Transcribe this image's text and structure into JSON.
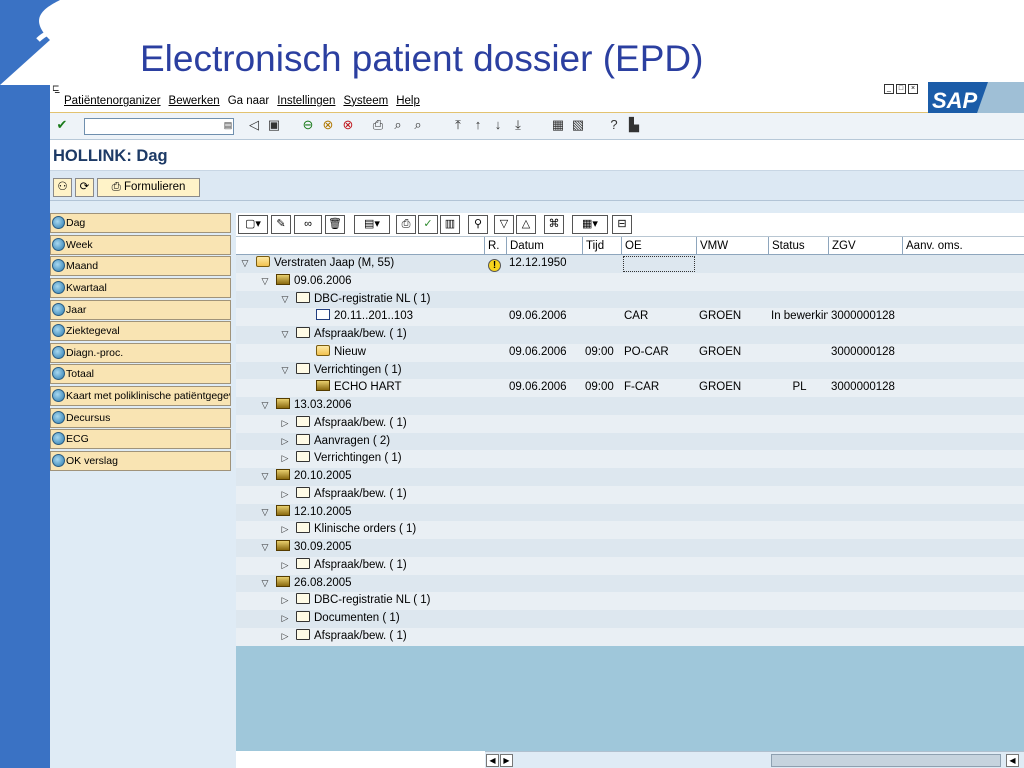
{
  "slide": {
    "title": "Electronisch patient dossier (EPD)"
  },
  "menu": [
    "Patiëntenorganizer",
    "Bewerken",
    "Ga naar",
    "Instellingen",
    "Systeem",
    "Help"
  ],
  "brand": {
    "logo_text": "SAP"
  },
  "screen": {
    "title": "HOLLINK: Dag"
  },
  "app_toolbar": {
    "formulieren_label": "Formulieren"
  },
  "nav_items": [
    "Dag",
    "Week",
    "Maand",
    "Kwartaal",
    "Jaar",
    "Ziektegeval",
    "Diagn.-proc.",
    "Totaal",
    "Kaart met poliklinische patiëntgegevens",
    "Decursus",
    "ECG",
    "OK verslag"
  ],
  "columns": {
    "r": "R.",
    "datum": "Datum",
    "tijd": "Tijd",
    "oe": "OE",
    "vmw": "VMW",
    "status": "Status",
    "zgv": "ZGV",
    "aanv": "Aanv. oms."
  },
  "rows": [
    {
      "level": 0,
      "toggle": "▽",
      "icon": "person",
      "label": "Verstraten Jaap (M, 55)",
      "r": "!",
      "datum": "12.12.1950",
      "tijd": "",
      "oe": "",
      "vmw": "",
      "status": "",
      "zgv": ""
    },
    {
      "level": 1,
      "toggle": "▽",
      "icon": "date",
      "label": "09.06.2006",
      "r": "",
      "datum": "",
      "tijd": "",
      "oe": "",
      "vmw": "",
      "status": "",
      "zgv": ""
    },
    {
      "level": 2,
      "toggle": "▽",
      "icon": "folder",
      "label": "DBC-registratie NL ( 1)",
      "r": "",
      "datum": "",
      "tijd": "",
      "oe": "",
      "vmw": "",
      "status": "",
      "zgv": ""
    },
    {
      "level": 3,
      "toggle": "",
      "icon": "doc",
      "label": "20.11..201..103",
      "r": "",
      "datum": "09.06.2006",
      "tijd": "",
      "oe": "CAR",
      "vmw": "GROEN",
      "status": "In bewerking",
      "zgv": "3000000128"
    },
    {
      "level": 2,
      "toggle": "▽",
      "icon": "folder",
      "label": "Afspraak/bew. ( 1)",
      "r": "",
      "datum": "",
      "tijd": "",
      "oe": "",
      "vmw": "",
      "status": "",
      "zgv": ""
    },
    {
      "level": 3,
      "toggle": "",
      "icon": "person",
      "label": "Nieuw",
      "r": "",
      "datum": "09.06.2006",
      "tijd": "09:00",
      "oe": "PO-CAR",
      "vmw": "GROEN",
      "status": "",
      "zgv": "3000000128"
    },
    {
      "level": 2,
      "toggle": "▽",
      "icon": "folder",
      "label": "Verrichtingen ( 1)",
      "r": "",
      "datum": "",
      "tijd": "",
      "oe": "",
      "vmw": "",
      "status": "",
      "zgv": ""
    },
    {
      "level": 3,
      "toggle": "",
      "icon": "date",
      "label": "ECHO HART",
      "r": "",
      "datum": "09.06.2006",
      "tijd": "09:00",
      "oe": "F-CAR",
      "vmw": "GROEN",
      "status": "PL",
      "zgv": "3000000128"
    },
    {
      "level": 1,
      "toggle": "▽",
      "icon": "date",
      "label": "13.03.2006",
      "r": "",
      "datum": "",
      "tijd": "",
      "oe": "",
      "vmw": "",
      "status": "",
      "zgv": ""
    },
    {
      "level": 2,
      "toggle": "▷",
      "icon": "folder",
      "label": "Afspraak/bew. ( 1)",
      "r": "",
      "datum": "",
      "tijd": "",
      "oe": "",
      "vmw": "",
      "status": "",
      "zgv": ""
    },
    {
      "level": 2,
      "toggle": "▷",
      "icon": "folder",
      "label": "Aanvragen ( 2)",
      "r": "",
      "datum": "",
      "tijd": "",
      "oe": "",
      "vmw": "",
      "status": "",
      "zgv": ""
    },
    {
      "level": 2,
      "toggle": "▷",
      "icon": "folder",
      "label": "Verrichtingen ( 1)",
      "r": "",
      "datum": "",
      "tijd": "",
      "oe": "",
      "vmw": "",
      "status": "",
      "zgv": ""
    },
    {
      "level": 1,
      "toggle": "▽",
      "icon": "date",
      "label": "20.10.2005",
      "r": "",
      "datum": "",
      "tijd": "",
      "oe": "",
      "vmw": "",
      "status": "",
      "zgv": ""
    },
    {
      "level": 2,
      "toggle": "▷",
      "icon": "folder",
      "label": "Afspraak/bew. ( 1)",
      "r": "",
      "datum": "",
      "tijd": "",
      "oe": "",
      "vmw": "",
      "status": "",
      "zgv": ""
    },
    {
      "level": 1,
      "toggle": "▽",
      "icon": "date",
      "label": "12.10.2005",
      "r": "",
      "datum": "",
      "tijd": "",
      "oe": "",
      "vmw": "",
      "status": "",
      "zgv": ""
    },
    {
      "level": 2,
      "toggle": "▷",
      "icon": "folder",
      "label": "Klinische orders ( 1)",
      "r": "",
      "datum": "",
      "tijd": "",
      "oe": "",
      "vmw": "",
      "status": "",
      "zgv": ""
    },
    {
      "level": 1,
      "toggle": "▽",
      "icon": "date",
      "label": "30.09.2005",
      "r": "",
      "datum": "",
      "tijd": "",
      "oe": "",
      "vmw": "",
      "status": "",
      "zgv": ""
    },
    {
      "level": 2,
      "toggle": "▷",
      "icon": "folder",
      "label": "Afspraak/bew. ( 1)",
      "r": "",
      "datum": "",
      "tijd": "",
      "oe": "",
      "vmw": "",
      "status": "",
      "zgv": ""
    },
    {
      "level": 1,
      "toggle": "▽",
      "icon": "date",
      "label": "26.08.2005",
      "r": "",
      "datum": "",
      "tijd": "",
      "oe": "",
      "vmw": "",
      "status": "",
      "zgv": ""
    },
    {
      "level": 2,
      "toggle": "▷",
      "icon": "folder",
      "label": "DBC-registratie NL ( 1)",
      "r": "",
      "datum": "",
      "tijd": "",
      "oe": "",
      "vmw": "",
      "status": "",
      "zgv": ""
    },
    {
      "level": 2,
      "toggle": "▷",
      "icon": "folder",
      "label": "Documenten ( 1)",
      "r": "",
      "datum": "",
      "tijd": "",
      "oe": "",
      "vmw": "",
      "status": "",
      "zgv": ""
    },
    {
      "level": 2,
      "toggle": "▷",
      "icon": "folder",
      "label": "Afspraak/bew. ( 1)",
      "r": "",
      "datum": "",
      "tijd": "",
      "oe": "",
      "vmw": "",
      "status": "",
      "zgv": ""
    }
  ],
  "colors": {
    "band": "#3a72c4",
    "title": "#2b3fa0",
    "oe_highlight": "#fdc43a",
    "nav_button": "#f9e4b3"
  }
}
